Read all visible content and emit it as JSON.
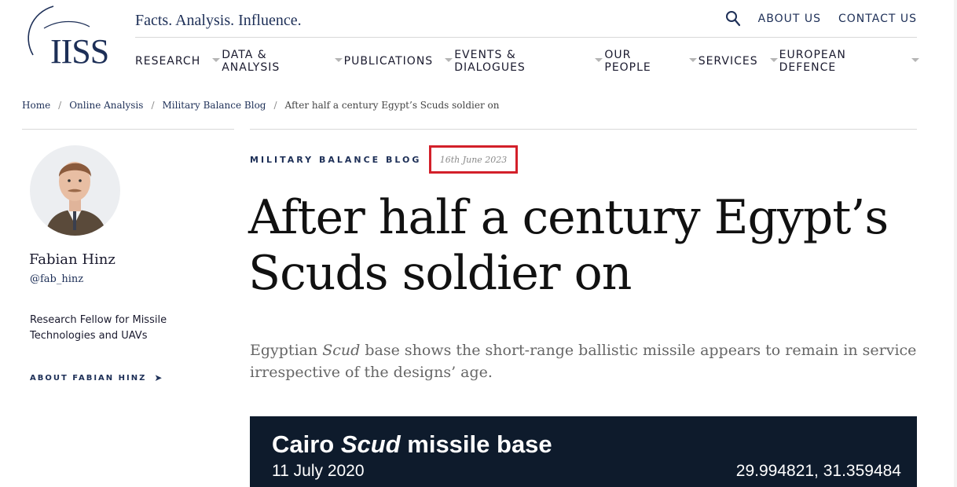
{
  "header": {
    "logo_text": "IISS",
    "tagline": "Facts. Analysis. Influence.",
    "top_links": [
      "ABOUT US",
      "CONTACT US"
    ],
    "search_icon": "search-icon"
  },
  "nav": {
    "items": [
      {
        "label": "RESEARCH"
      },
      {
        "label": "DATA & ANALYSIS"
      },
      {
        "label": "PUBLICATIONS"
      },
      {
        "label": "EVENTS & DIALOGUES"
      },
      {
        "label": "OUR PEOPLE"
      },
      {
        "label": "SERVICES"
      },
      {
        "label": "EUROPEAN DEFENCE"
      }
    ]
  },
  "breadcrumb": {
    "items": [
      "Home",
      "Online Analysis",
      "Military Balance Blog"
    ],
    "current": "After half a century Egypt’s Scuds soldier on"
  },
  "author": {
    "name": "Fabian Hinz",
    "handle": "@fab_hinz",
    "bio": "Research Fellow for Missile Technologies and UAVs",
    "about_link": "ABOUT FABIAN HINZ",
    "about_arrow": "➤"
  },
  "article": {
    "kicker": "MILITARY BALANCE BLOG",
    "date": "16th June 2023",
    "title": "After half a century Egypt’s Scuds soldier on",
    "standfirst_before": "Egyptian ",
    "standfirst_em": "Scud",
    "standfirst_after": " base shows the short-range ballistic missile appears to remain in service irrespective of the designs’ age."
  },
  "figure": {
    "title_before": "Cairo ",
    "title_em": "Scud",
    "title_after": " missile base",
    "date": "11 July 2020",
    "coords": "29.994821, 31.359484"
  },
  "colors": {
    "brand_navy": "#1d2f57",
    "highlight_red": "#d3202a",
    "figure_bg": "#0e1b2c"
  }
}
